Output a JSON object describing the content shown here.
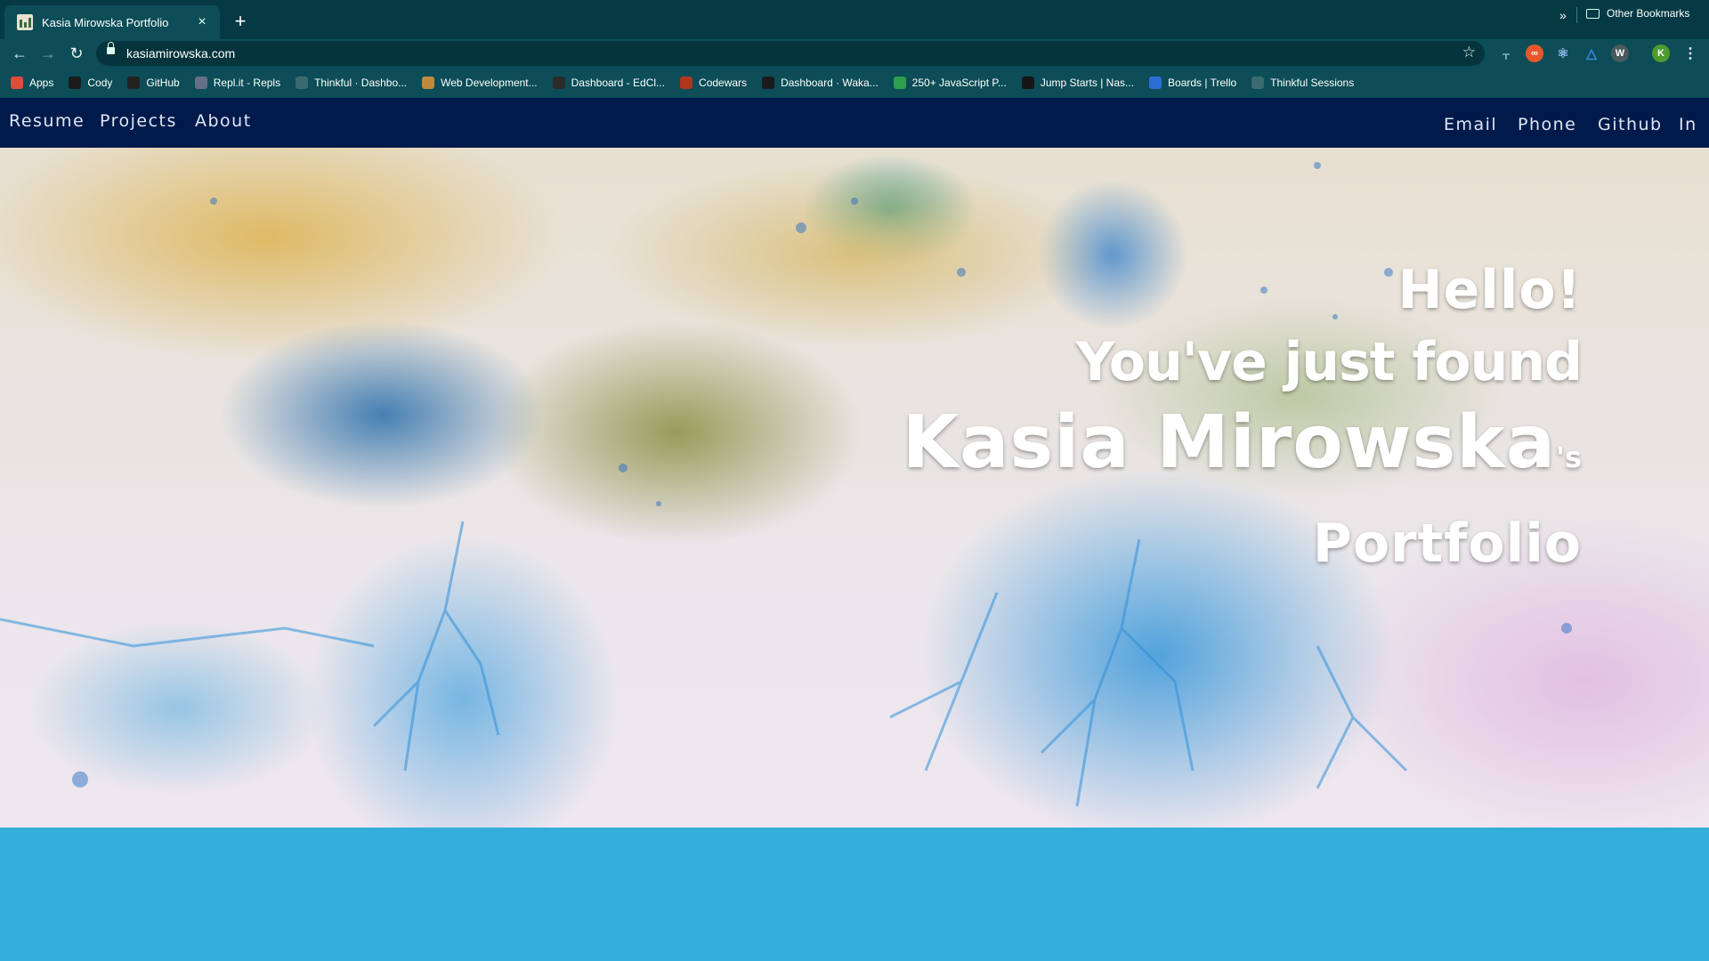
{
  "browser": {
    "tab_title": "Kasia Mirowska Portfolio",
    "tab_close": "×",
    "new_tab": "+",
    "url": "kasiamirowska.com",
    "profile_initial": "K",
    "bookmarks": [
      {
        "label": "Apps",
        "icon": "apps-grid-icon",
        "color": "#e24a3b"
      },
      {
        "label": "Cody",
        "icon": "cody-icon",
        "color": "#1b1b1b"
      },
      {
        "label": "GitHub",
        "icon": "github-icon",
        "color": "#222222"
      },
      {
        "label": "Repl.it - Repls",
        "icon": "replit-icon",
        "color": "#667085"
      },
      {
        "label": "Thinkful · Dashbo...",
        "icon": "thinkful-icon",
        "color": "#3b6a70"
      },
      {
        "label": "Web Development...",
        "icon": "owl-icon",
        "color": "#c08a3e"
      },
      {
        "label": "Dashboard - EdCl...",
        "icon": "edclub-icon",
        "color": "#2b2b2b"
      },
      {
        "label": "Codewars",
        "icon": "codewars-icon",
        "color": "#b1361e"
      },
      {
        "label": "Dashboard · Waka...",
        "icon": "wakatime-icon",
        "color": "#1a1a1a"
      },
      {
        "label": "250+ JavaScript P...",
        "icon": "javascript-icon",
        "color": "#2e9e4f"
      },
      {
        "label": "Jump Starts | Nas...",
        "icon": "nashville-icon",
        "color": "#151515"
      },
      {
        "label": "Boards | Trello",
        "icon": "trello-icon",
        "color": "#2a6fd4"
      },
      {
        "label": "Thinkful Sessions",
        "icon": "thinkful-icon",
        "color": "#3b6a70"
      }
    ],
    "more_bookmarks": "»",
    "other_bookmarks": "Other Bookmarks"
  },
  "nav": {
    "left": [
      "Resume",
      "Projects",
      "About"
    ],
    "right": [
      "Email",
      "Phone",
      "Github",
      "In"
    ]
  },
  "hero": {
    "line1": "Hello!",
    "line2": "You've just found",
    "name": "Kasia Mirowska",
    "possessive": "'s",
    "line4": "Portfolio"
  },
  "colors": {
    "chrome_dark": "#053a44",
    "chrome": "#0c4d57",
    "nav_bg": "#001a4c",
    "footer_band": "#34aedb"
  }
}
